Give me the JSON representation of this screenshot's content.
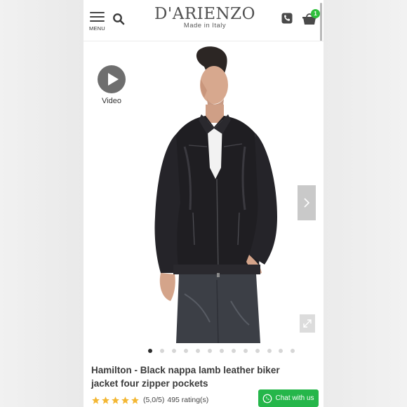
{
  "header": {
    "menu_label": "MENU",
    "logo_text": "D'ARIENZO",
    "logo_tagline": "Made in Italy",
    "cart_count": "1",
    "accent_color": "#2fbf3c"
  },
  "gallery": {
    "video_label": "Video",
    "image_subject": "model-wearing-black-leather-jacket",
    "slide_count": 13,
    "active_slide": 1
  },
  "product": {
    "title": "Hamilton - Black nappa lamb leather biker jacket four zipper pockets",
    "rating_value": 5.0,
    "rating_text": "(5,0/5)",
    "ratings_count": "495 rating(s)",
    "star_color": "#f3b733"
  },
  "chat": {
    "label": "Chat with us",
    "icon": "whatsapp-icon",
    "color": "#25b64a"
  }
}
